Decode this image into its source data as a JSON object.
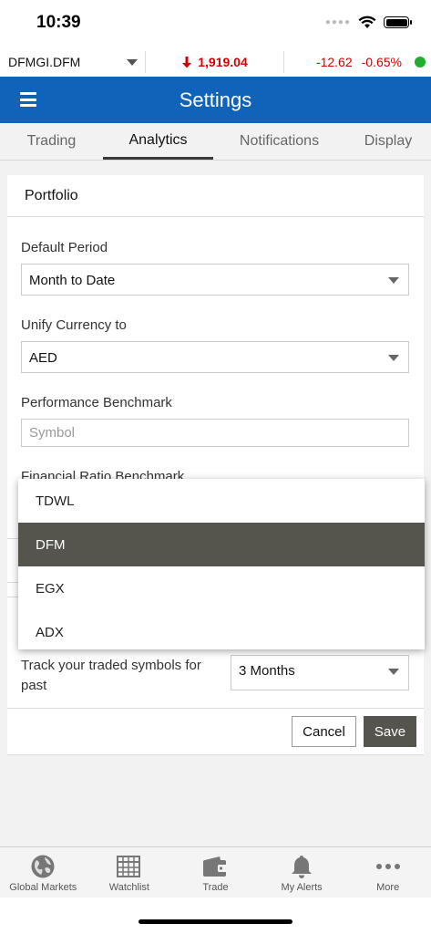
{
  "status_bar": {
    "time": "10:39"
  },
  "ticker": {
    "symbol": "DFMGI.DFM",
    "index_value": "1,919.04",
    "change": "-12.62",
    "change_percent": "-0.65%",
    "down_color": "#d40000",
    "status_color": "#1fae2b"
  },
  "header": {
    "title": "Settings",
    "color": "#1063b8"
  },
  "tabs": [
    {
      "label": "Trading",
      "active": false
    },
    {
      "label": "Analytics",
      "active": true
    },
    {
      "label": "Notifications",
      "active": false
    },
    {
      "label": "Display",
      "active": false
    }
  ],
  "portfolio": {
    "title": "Portfolio",
    "default_period": {
      "label": "Default Period",
      "value": "Month to Date"
    },
    "unify_currency": {
      "label": "Unify Currency to",
      "value": "AED"
    },
    "performance_benchmark": {
      "label": "Performance Benchmark",
      "placeholder": "Symbol"
    },
    "financial_ratio_benchmark": {
      "label": "Financial Ratio Benchmark"
    },
    "track_traded": {
      "label": "Track your traded symbols for past",
      "value": "3 Months"
    }
  },
  "dropdown": {
    "options": [
      "TDWL",
      "DFM",
      "EGX",
      "ADX"
    ],
    "selected": "DFM"
  },
  "buttons": {
    "cancel": "Cancel",
    "save": "Save"
  },
  "tabbar": [
    {
      "label": "Global Markets",
      "icon": "globe-icon"
    },
    {
      "label": "Watchlist",
      "icon": "watchlist-icon"
    },
    {
      "label": "Trade",
      "icon": "wallet-icon"
    },
    {
      "label": "My Alerts",
      "icon": "bell-icon"
    },
    {
      "label": "More",
      "icon": "more-icon"
    }
  ]
}
